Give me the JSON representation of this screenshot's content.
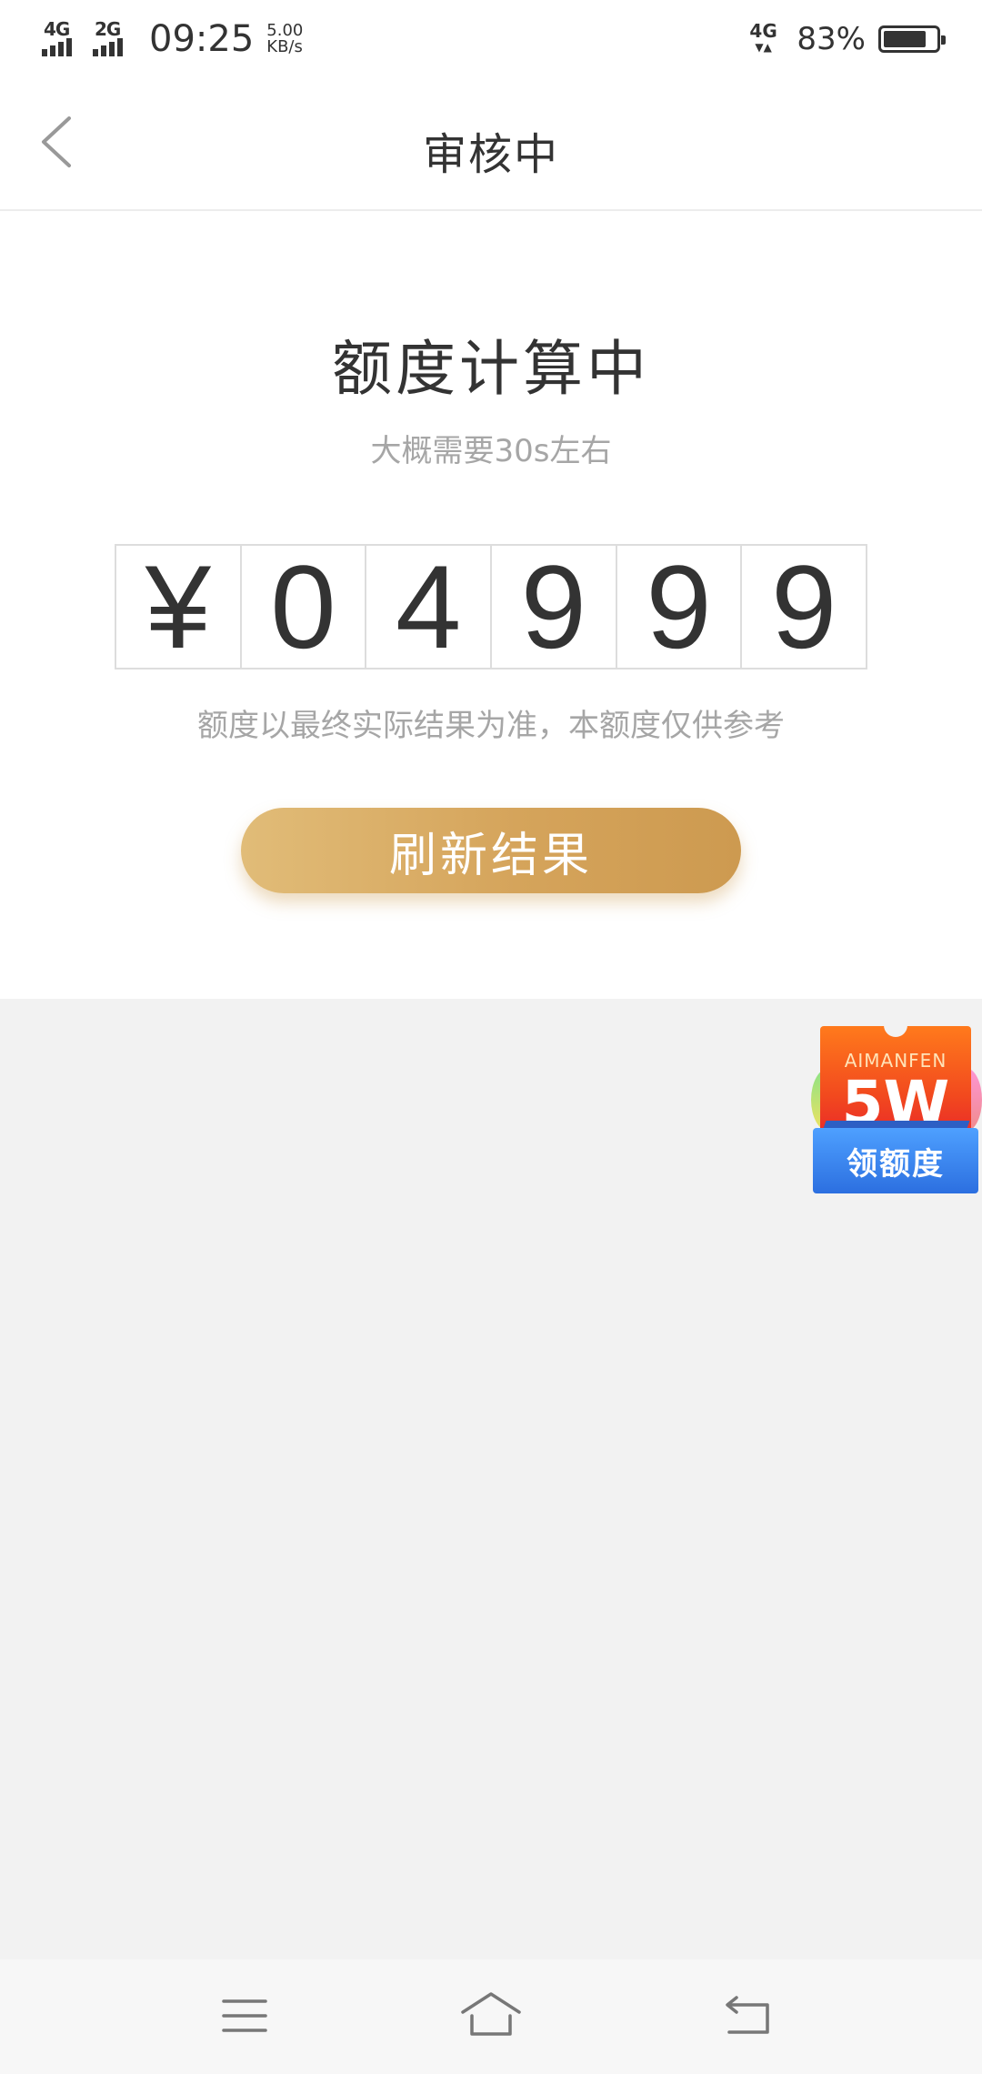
{
  "status_bar": {
    "signal1_label": "4G",
    "signal2_label": "2G",
    "time": "09:25",
    "speed_value": "5.00",
    "speed_unit": "KB/s",
    "network_label": "4G",
    "battery_percent": "83%",
    "battery_level": 0.83
  },
  "header": {
    "title": "审核中",
    "back_icon": "chevron-left-icon"
  },
  "main": {
    "title": "额度计算中",
    "subtitle": "大概需要30s左右",
    "amount_digits": [
      "¥",
      "0",
      "4",
      "9",
      "9",
      "9"
    ],
    "disclaimer": "额度以最终实际结果为准，本额度仅供参考",
    "refresh_button_label": "刷新结果"
  },
  "promo": {
    "brand": "AIMANFEN",
    "amount": "5W",
    "label": "领额度"
  },
  "system_nav": {
    "menu_icon": "menu-icon",
    "home_icon": "home-icon",
    "back_icon": "return-icon"
  },
  "colors": {
    "accent_gold_start": "#e1bc78",
    "accent_gold_end": "#cd9a50",
    "text_primary": "#333333",
    "text_secondary": "#a6a6a6",
    "page_bg": "#f2f2f2"
  }
}
